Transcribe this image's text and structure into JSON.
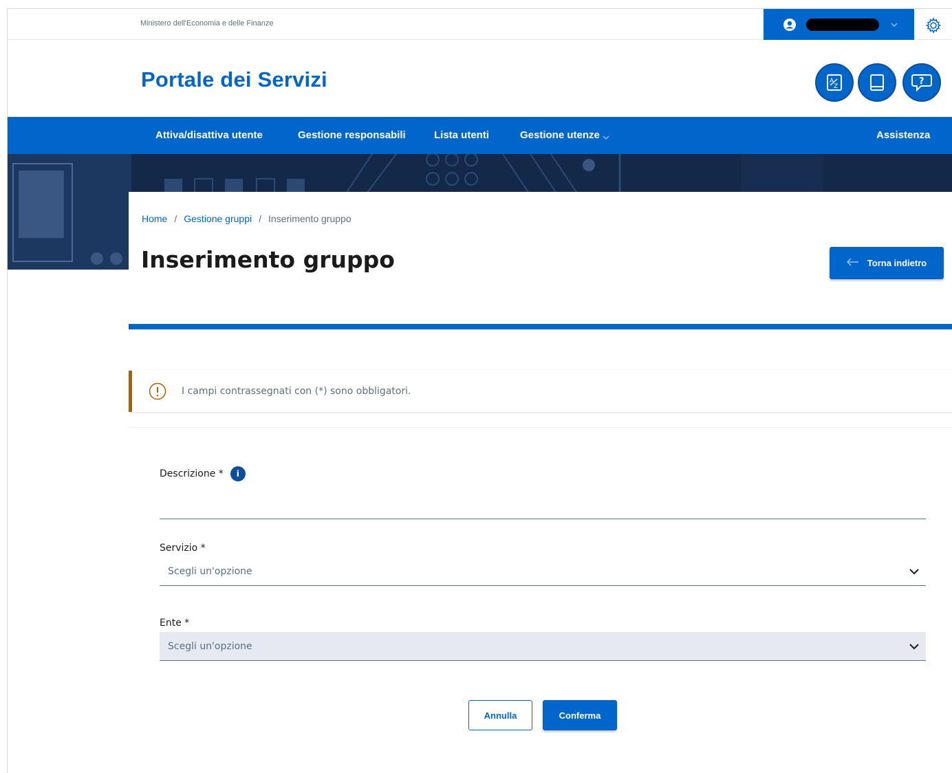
{
  "slim_header": {
    "ministry": "Ministero dell'Economia e delle Finanze",
    "user_icon": "user-circle-icon",
    "settings_icon": "gear-icon"
  },
  "header": {
    "title": "Portale dei Servizi",
    "icons": [
      "translate-icon",
      "book-icon",
      "help-chat-icon"
    ]
  },
  "nav": {
    "items": [
      {
        "label": "Attiva/disattiva utente"
      },
      {
        "label": "Gestione responsabili"
      },
      {
        "label": "Lista utenti"
      },
      {
        "label": "Gestione utenze"
      }
    ],
    "assistenza": "Assistenza"
  },
  "breadcrumb": {
    "home": "Home",
    "separator": "/",
    "parent": "Gestione gruppi",
    "current": "Inserimento gruppo"
  },
  "page": {
    "title": "Inserimento gruppo",
    "back_button": "Torna indietro"
  },
  "callout": {
    "text": "I campi contrassegnati con (*) sono obbligatori."
  },
  "form": {
    "descrizione_label": "Descrizione *",
    "descrizione_value": "",
    "servizio_label": "Servizio *",
    "servizio_placeholder": "Scegli un'opzione",
    "ente_label": "Ente *",
    "ente_placeholder": "Scegli un'opzione",
    "cancel_label": "Annulla",
    "confirm_label": "Conferma"
  },
  "colors": {
    "primary": "#0066cc",
    "nav_bg": "#0066cc",
    "hero_bg": "#14284a",
    "callout_border": "#a66300",
    "disabled_select": "#e6e9f2"
  }
}
